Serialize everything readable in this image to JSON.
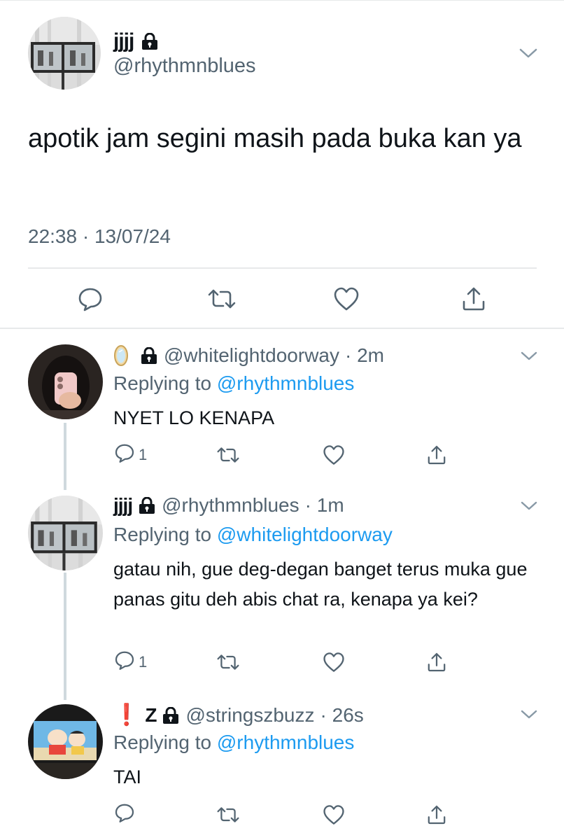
{
  "main_tweet": {
    "display_name": "jjjj",
    "handle": "@rhythmnblues",
    "text": "apotik jam segini masih pada buka kan ya",
    "timestamp": "22:38 · 13/07/24",
    "icons": [
      "lock-icon",
      "chevron-down-icon",
      "reply-icon",
      "retweet-icon",
      "like-icon",
      "share-icon"
    ]
  },
  "replies": [
    {
      "emoji_name": "mirror-emoji",
      "display_name": "",
      "handle": "@whitelightdoorway",
      "time": "· 2m",
      "replying_label": "Replying to",
      "replying_to": "@rhythmnblues",
      "text": "NYET LO KENAPA",
      "reply_count": "1"
    },
    {
      "display_name": "jjjj",
      "handle": "@rhythmnblues",
      "time": "· 1m",
      "replying_label": "Replying to",
      "replying_to": "@whitelightdoorway",
      "text": "gatau nih, gue deg-degan banget terus muka gue panas gitu deh abis chat ra, kenapa ya kei?",
      "reply_count": "1"
    },
    {
      "display_name_prefix": "❗",
      "display_name": "Z",
      "handle": "@stringszbuzz",
      "time": "· 26s",
      "replying_label": "Replying to",
      "replying_to": "@rhythmnblues",
      "text": "TAI",
      "reply_count": ""
    }
  ],
  "colors": {
    "text": "#0f1419",
    "secondary": "#536471",
    "link": "#1d9bf0",
    "divider": "#e7e9ea",
    "thread_line": "#cfd9de"
  }
}
